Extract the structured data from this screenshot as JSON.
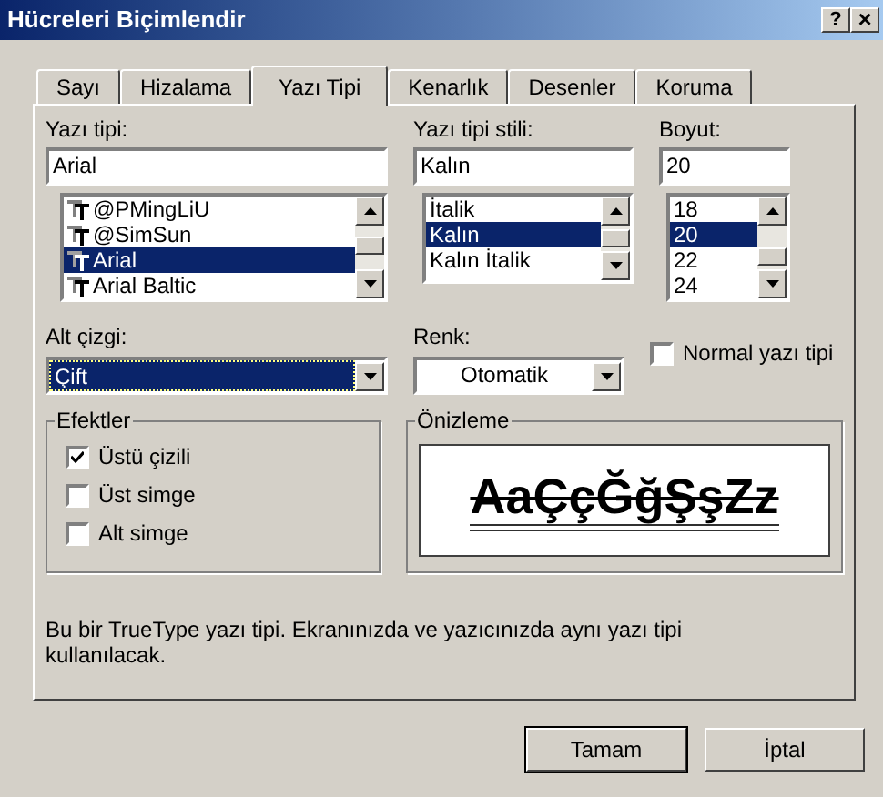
{
  "window": {
    "title": "Hücreleri Biçimlendir",
    "help_button": "?",
    "close_button": "×"
  },
  "tabs": [
    {
      "label": "Sayı",
      "selected": false
    },
    {
      "label": "Hizalama",
      "selected": false
    },
    {
      "label": "Yazı Tipi",
      "selected": true
    },
    {
      "label": "Kenarlık",
      "selected": false
    },
    {
      "label": "Desenler",
      "selected": false
    },
    {
      "label": "Koruma",
      "selected": false
    }
  ],
  "font": {
    "label": "Yazı tipi:",
    "value": "Arial",
    "items": [
      {
        "label": "@PMingLiU",
        "selected": false
      },
      {
        "label": "@SimSun",
        "selected": false
      },
      {
        "label": "Arial",
        "selected": true
      },
      {
        "label": "Arial Baltic",
        "selected": false
      }
    ]
  },
  "font_style": {
    "label": "Yazı tipi stili:",
    "value": "Kalın",
    "items": [
      {
        "label": "İtalik",
        "selected": false
      },
      {
        "label": "Kalın",
        "selected": true
      },
      {
        "label": "Kalın İtalik",
        "selected": false
      }
    ]
  },
  "size": {
    "label": "Boyut:",
    "value": "20",
    "items": [
      {
        "label": "18",
        "selected": false
      },
      {
        "label": "20",
        "selected": true
      },
      {
        "label": "22",
        "selected": false
      },
      {
        "label": "24",
        "selected": false
      }
    ]
  },
  "underline": {
    "label": "Alt çizgi:",
    "value": "Çift"
  },
  "color": {
    "label": "Renk:",
    "value": "Otomatik"
  },
  "normal_font": {
    "label": "Normal yazı tipi",
    "checked": false
  },
  "effects": {
    "title": "Efektler",
    "items": [
      {
        "label": "Üstü çizili",
        "checked": true
      },
      {
        "label": "Üst simge",
        "checked": false
      },
      {
        "label": "Alt simge",
        "checked": false
      }
    ]
  },
  "preview": {
    "title": "Önizleme",
    "text": "AaÇçĞğŞşZz"
  },
  "description": "Bu bir TrueType yazı tipi. Ekranınızda ve yazıcınızda aynı yazı tipi kullanılacak.",
  "buttons": [
    {
      "label": "Tamam",
      "default": true
    },
    {
      "label": "İptal",
      "default": false
    }
  ]
}
